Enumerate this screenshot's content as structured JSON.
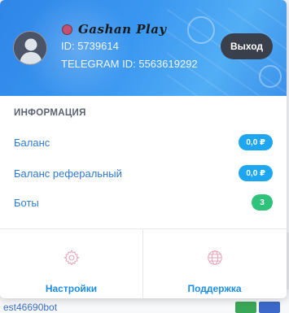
{
  "background": {
    "bottom_text": "est46690bot"
  },
  "profile": {
    "name": "Gashan Play",
    "id_text": "ID: 5739614",
    "telegram_id_text": "TELEGRAM ID: 5563619292",
    "logout_label": "Выход",
    "status_color": "#c2506f"
  },
  "info": {
    "title": "ИНФОРМАЦИЯ",
    "rows": [
      {
        "label": "Баланс",
        "value": "0,0 ₽",
        "badge_color": "#1ea7f0"
      },
      {
        "label": "Баланс реферальный",
        "value": "0,0 ₽",
        "badge_color": "#1ea7f0"
      },
      {
        "label": "Боты",
        "value": "3",
        "badge_color": "#2fc27b"
      }
    ]
  },
  "footer": {
    "settings": {
      "label": "Настройки",
      "icon": "gear-icon"
    },
    "support": {
      "label": "Поддержка",
      "icon": "globe-icon"
    }
  },
  "colors": {
    "header_blue": "#3a97f0",
    "logout_bg": "#3a3f4c",
    "link_blue": "#2f7ad0"
  }
}
